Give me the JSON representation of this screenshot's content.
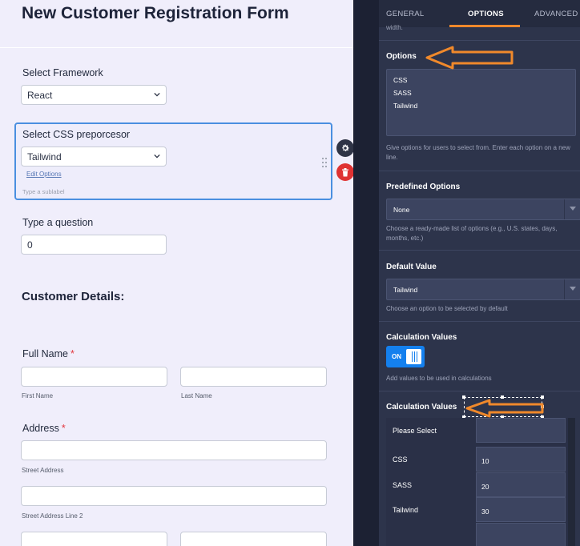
{
  "form": {
    "title": "New Customer Registration Form",
    "select_framework": {
      "label": "Select Framework",
      "value": "React"
    },
    "select_css": {
      "label": "Select CSS preporcesor",
      "value": "Tailwind",
      "edit_options": "Edit Options",
      "sublabel_placeholder": "Type a sublabel"
    },
    "question": {
      "label": "Type a question",
      "value": "0"
    },
    "section_heading": "Customer Details:",
    "full_name": {
      "label": "Full Name",
      "required_mark": "*",
      "first_sublabel": "First Name",
      "last_sublabel": "Last Name"
    },
    "address": {
      "label": "Address",
      "required_mark": "*",
      "street_sublabel": "Street Address",
      "street2_sublabel": "Street Address Line 2"
    }
  },
  "panel": {
    "tabs": [
      {
        "label": "GENERAL",
        "active": false
      },
      {
        "label": "OPTIONS",
        "active": true
      },
      {
        "label": "ADVANCED",
        "active": false
      }
    ],
    "cut_text": "width.",
    "options": {
      "title": "Options",
      "values": [
        "CSS",
        "SASS",
        "Tailwind"
      ],
      "help": "Give options for users to select from. Enter each option on a new line."
    },
    "predefined": {
      "title": "Predefined Options",
      "value": "None",
      "help": "Choose a ready-made list of options (e.g., U.S. states, days, months, etc.)"
    },
    "default_value": {
      "title": "Default Value",
      "value": "Tailwind",
      "help": "Choose an option to be selected by default"
    },
    "calc_toggle": {
      "title": "Calculation Values",
      "state": "ON",
      "help": "Add values to be used in calculations"
    },
    "calc_values": {
      "title": "Calculation Values",
      "rows": [
        {
          "label": "Please Select",
          "value": ""
        },
        {
          "label": "CSS",
          "value": "10"
        },
        {
          "label": "SASS",
          "value": "20"
        },
        {
          "label": "Tailwind",
          "value": "30"
        },
        {
          "label": "",
          "value": ""
        }
      ]
    }
  },
  "colors": {
    "accent_orange": "#f0892b",
    "toggle_blue": "#1480ee",
    "panel_bg": "#2d344b",
    "form_bg": "#f0eefb",
    "selected_border": "#4a8fe0",
    "delete_red": "#df3232"
  },
  "icons": [
    "chevron-down-icon",
    "gear-icon",
    "trash-icon",
    "drag-handle-icon",
    "arrow-left-icon"
  ]
}
